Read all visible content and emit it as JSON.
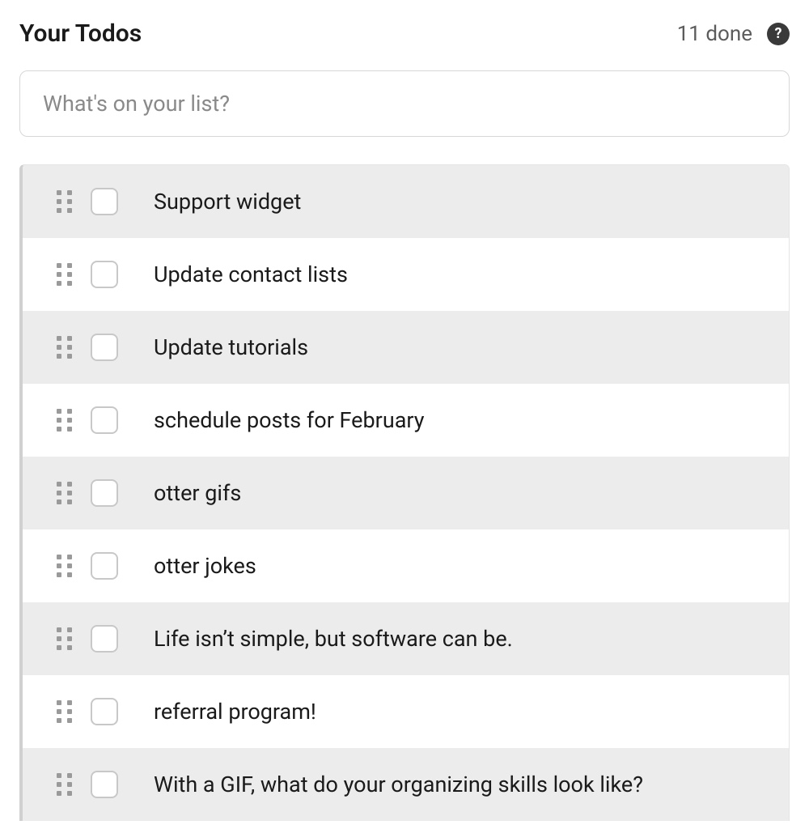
{
  "header": {
    "title": "Your Todos",
    "done_label": "11 done"
  },
  "input": {
    "placeholder": "What's on your list?",
    "value": ""
  },
  "todos": [
    {
      "text": "Support widget",
      "checked": false
    },
    {
      "text": "Update contact lists",
      "checked": false
    },
    {
      "text": "Update tutorials",
      "checked": false
    },
    {
      "text": "schedule posts for February",
      "checked": false
    },
    {
      "text": "otter gifs",
      "checked": false
    },
    {
      "text": "otter jokes",
      "checked": false
    },
    {
      "text": "Life isn’t simple, but software can be.",
      "checked": false
    },
    {
      "text": "referral program!",
      "checked": false
    },
    {
      "text": "With a GIF, what do your organizing skills look like?",
      "checked": false
    }
  ]
}
